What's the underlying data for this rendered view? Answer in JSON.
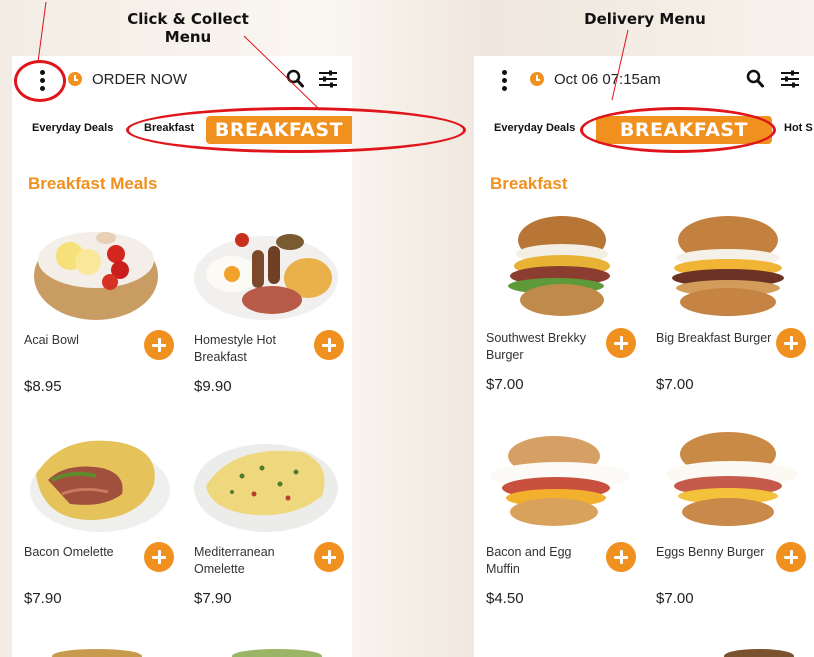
{
  "callouts": {
    "click_collect": "Click & Collect\nMenu",
    "delivery": "Delivery Menu"
  },
  "left_panel": {
    "status_label": "ORDER NOW",
    "tabs": [
      "Everyday Deals",
      "Breakfast"
    ],
    "highlight_tab": "BREAKFAST MEALS",
    "section_title": "Breakfast Meals",
    "items": [
      {
        "name": "Acai Bowl",
        "price": "$8.95"
      },
      {
        "name": "Homestyle Hot Breakfast",
        "price": "$9.90"
      },
      {
        "name": "Bacon Omelette",
        "price": "$7.90"
      },
      {
        "name": "Mediterranean Omelette",
        "price": "$7.90"
      }
    ]
  },
  "right_panel": {
    "status_label": "Oct 06 07:15am",
    "tabs": [
      "Everyday Deals",
      "Hot S"
    ],
    "highlight_tab": "BREAKFAST",
    "section_title": "Breakfast",
    "items": [
      {
        "name": "Southwest Brekky Burger",
        "price": "$7.00"
      },
      {
        "name": "Big Breakfast Burger",
        "price": "$7.00"
      },
      {
        "name": "Bacon and Egg Muffin",
        "price": "$4.50"
      },
      {
        "name": "Eggs Benny Burger",
        "price": "$7.00"
      }
    ]
  },
  "icons": [
    "menu-kebab-icon",
    "clock-icon",
    "search-icon",
    "filter-icon",
    "add-icon"
  ],
  "colors": {
    "accent": "#f0901e",
    "annotation": "#e0141b"
  }
}
